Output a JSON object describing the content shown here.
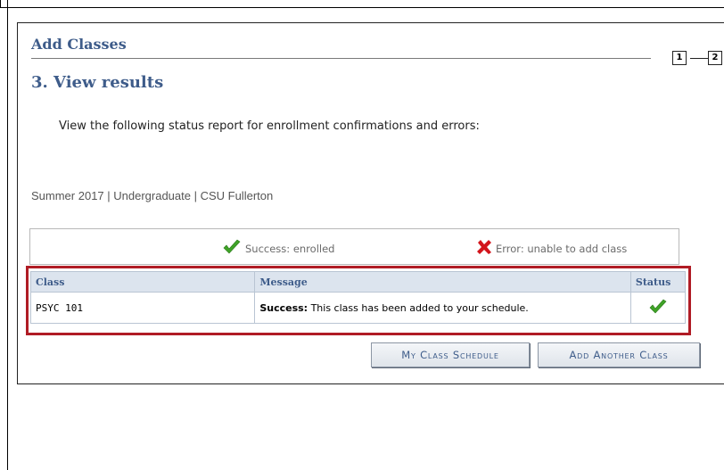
{
  "header": {
    "title": "Add Classes",
    "step_title": "3.  View results",
    "steps": [
      "1",
      "2"
    ]
  },
  "instructions": "View the following status report for enrollment confirmations and errors:",
  "term_info": "Summer 2017 | Undergraduate | CSU Fullerton",
  "legend": {
    "success": "Success: enrolled",
    "error": "Error: unable to add class",
    "success_icon": "check-icon",
    "error_icon": "x-icon"
  },
  "results_table": {
    "columns": [
      "Class",
      "Message",
      "Status"
    ],
    "rows": [
      {
        "class": "PSYC  101",
        "message_bold": "Success:",
        "message_text": " This class has been added to your schedule.",
        "status_icon": "check-icon"
      }
    ]
  },
  "buttons": {
    "my_schedule": "My Class Schedule",
    "add_another": "Add Another Class"
  },
  "colors": {
    "heading": "#3e5c8a",
    "success": "#3fa327",
    "error": "#d3141b",
    "highlight_border": "#b01c25"
  }
}
